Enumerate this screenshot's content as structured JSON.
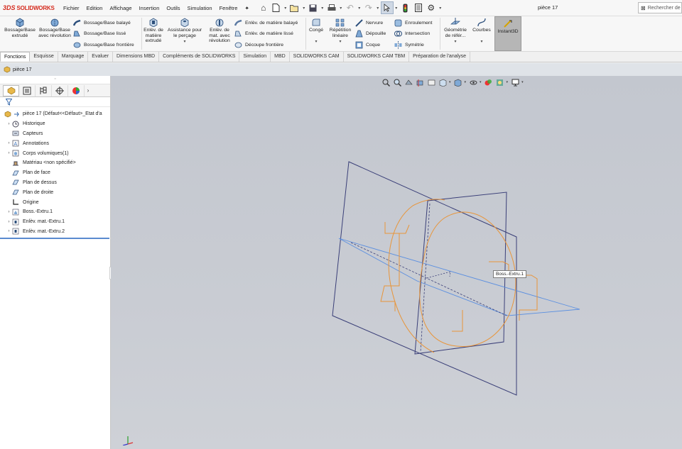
{
  "app": {
    "brand_prefix": "3DS",
    "brand": "SOLIDWORKS",
    "doc_title": "pièce 17"
  },
  "menu": [
    "Fichier",
    "Edition",
    "Affichage",
    "Insertion",
    "Outils",
    "Simulation",
    "Fenêtre"
  ],
  "search": {
    "placeholder": "Rechercher de"
  },
  "ribbon": {
    "boss_extrude": "Bossage/Base extrudé",
    "boss_revolve": "Bossage/Base avec révolution",
    "swept_boss": "Bossage/Base balayé",
    "lofted_boss": "Bossage/Base lissé",
    "boundary_boss": "Bossage/Base frontière",
    "extruded_cut": "Enlèv. de matière extrudé",
    "hole_wizard": "Assistance pour le perçage",
    "revolved_cut": "Enlèv. de mat. avec révolution",
    "swept_cut": "Enlèv. de matière balayé",
    "lofted_cut": "Enlèv. de matière lissé",
    "boundary_cut": "Découpe frontière",
    "fillet": "Congé",
    "linear_pattern": "Répétition linéaire",
    "rib": "Nervure",
    "draft": "Dépouille",
    "shell": "Coque",
    "wrap": "Enroulement",
    "intersect": "Intersection",
    "mirror": "Symétrie",
    "ref_geometry": "Géométrie de référ...",
    "curves": "Courbes",
    "instant3d": "Instant3D"
  },
  "tabs": [
    "Fonctions",
    "Esquisse",
    "Marquage",
    "Evaluer",
    "Dimensions MBD",
    "Compléments de SOLIDWORKS",
    "Simulation",
    "MBD",
    "SOLIDWORKS CAM",
    "SOLIDWORKS CAM TBM",
    "Préparation de l'analyse"
  ],
  "active_tab": "Fonctions",
  "breadcrumb": "pièce 17",
  "tree": {
    "root": "pièce 17  (Défaut<<Défaut>_Etat d'a",
    "items": [
      {
        "label": "Historique",
        "expandable": true,
        "icon": "history-icon"
      },
      {
        "label": "Capteurs",
        "expandable": false,
        "icon": "sensor-icon"
      },
      {
        "label": "Annotations",
        "expandable": true,
        "icon": "annotations-icon"
      },
      {
        "label": "Corps volumiques(1)",
        "expandable": true,
        "icon": "solid-bodies-icon"
      },
      {
        "label": "Matériau <non spécifié>",
        "expandable": false,
        "icon": "material-icon"
      },
      {
        "label": "Plan de face",
        "expandable": false,
        "icon": "plane-icon"
      },
      {
        "label": "Plan de dessus",
        "expandable": false,
        "icon": "plane-icon"
      },
      {
        "label": "Plan de droite",
        "expandable": false,
        "icon": "plane-icon"
      },
      {
        "label": "Origine",
        "expandable": false,
        "icon": "origin-icon"
      },
      {
        "label": "Boss.-Extru.1",
        "expandable": true,
        "icon": "extrude-feature-icon"
      },
      {
        "label": "Enlèv. mat.-Extru.1",
        "expandable": true,
        "icon": "cut-feature-icon"
      },
      {
        "label": "Enlèv. mat.-Extru.2",
        "expandable": true,
        "icon": "cut-feature-icon"
      }
    ]
  },
  "viewport": {
    "feature_tooltip": "Boss.-Extru.1"
  },
  "colors": {
    "sketch_orange": "#e8953a",
    "plane_navy": "#3a3f78",
    "axis_blue": "#5b8fe0",
    "background": "#c6c9d0"
  }
}
